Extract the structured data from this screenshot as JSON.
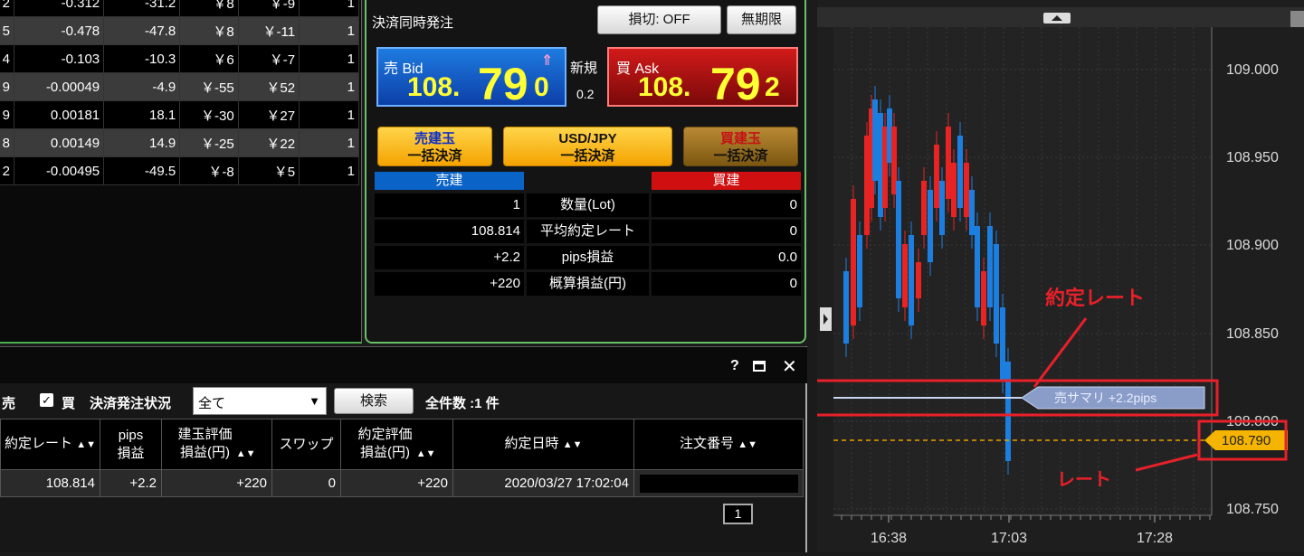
{
  "positions_table": {
    "rows": [
      [
        "2",
        "-0.312",
        "-31.2",
        "￥8",
        "￥-9",
        "1"
      ],
      [
        "5",
        "-0.478",
        "-47.8",
        "￥8",
        "￥-11",
        "1"
      ],
      [
        "4",
        "-0.103",
        "-10.3",
        "￥6",
        "￥-7",
        "1"
      ],
      [
        "9",
        "-0.00049",
        "-4.9",
        "￥-55",
        "￥52",
        "1"
      ],
      [
        "9",
        "0.00181",
        "18.1",
        "￥-30",
        "￥27",
        "1"
      ],
      [
        "8",
        "0.00149",
        "14.9",
        "￥-25",
        "￥22",
        "1"
      ],
      [
        "2",
        "-0.00495",
        "-49.5",
        "￥-8",
        "￥5",
        "1"
      ]
    ]
  },
  "order_panel": {
    "title": "決済同時発注",
    "stop_loss_btn": "損切: OFF",
    "expiry_btn": "無期限",
    "bid_label": "売 Bid",
    "bid_price_main": "108.",
    "bid_price_big": "79",
    "bid_price_small": "0",
    "new_label": "新規",
    "spread": "0.2",
    "ask_label": "買 Ask",
    "ask_price_main": "108.",
    "ask_price_big": "79",
    "ask_price_small": "2",
    "sell_pos_line1": "売建玉",
    "sell_pos_line2": "一括決済",
    "pair_line1": "USD/JPY",
    "pair_line2": "一括決済",
    "buy_pos_line1": "買建玉",
    "buy_pos_line2": "一括決済",
    "sell_header": "売建",
    "buy_header": "買建",
    "summary_rows": [
      {
        "sell": "1",
        "label": "数量(Lot)",
        "buy": "0"
      },
      {
        "sell": "108.814",
        "label": "平均約定レート",
        "buy": "0"
      },
      {
        "sell": "+2.2",
        "label": "pips損益",
        "buy": "0.0"
      },
      {
        "sell": "+220",
        "label": "概算損益(円)",
        "buy": "0"
      }
    ]
  },
  "bottom_panel": {
    "help_icon": "?",
    "filter_sell": "売",
    "filter_buy": "買",
    "status_label": "決済発注状況",
    "status_value": "全て",
    "search_btn": "検索",
    "total_count": "全件数 :1 件",
    "headers": [
      "約定レート",
      "pips\n損益",
      "建玉評価\n損益(円)",
      "スワップ",
      "約定評価\n損益(円)",
      "約定日時",
      "注文番号"
    ],
    "rows": [
      [
        "108.814",
        "+2.2",
        "+220",
        "0",
        "+220",
        "2020/03/27 17:02:04",
        ""
      ]
    ],
    "page": "1"
  },
  "chart": {
    "y_labels": [
      "109.000",
      "108.950",
      "108.900",
      "108.850",
      "108.800",
      "108.750"
    ],
    "x_labels": [
      "16:38",
      "17:03",
      "17:28"
    ],
    "summary_tag": "売サマリ +2.2pips",
    "rate_tag": "108.790",
    "annotation_fill": "約定レート",
    "annotation_rate": "レート"
  },
  "chart_data": {
    "type": "candlestick",
    "x_ticks": [
      "16:38",
      "17:03",
      "17:28"
    ],
    "ylim": [
      108.75,
      109.0
    ],
    "annotations": [
      "約定レート",
      "レート"
    ],
    "position_line": 108.814,
    "current_rate": 108.79
  },
  "colors": {
    "up": "#e82323",
    "down": "#1c7fe0",
    "accent_green": "#6abf69",
    "annot": "#e8202a"
  }
}
